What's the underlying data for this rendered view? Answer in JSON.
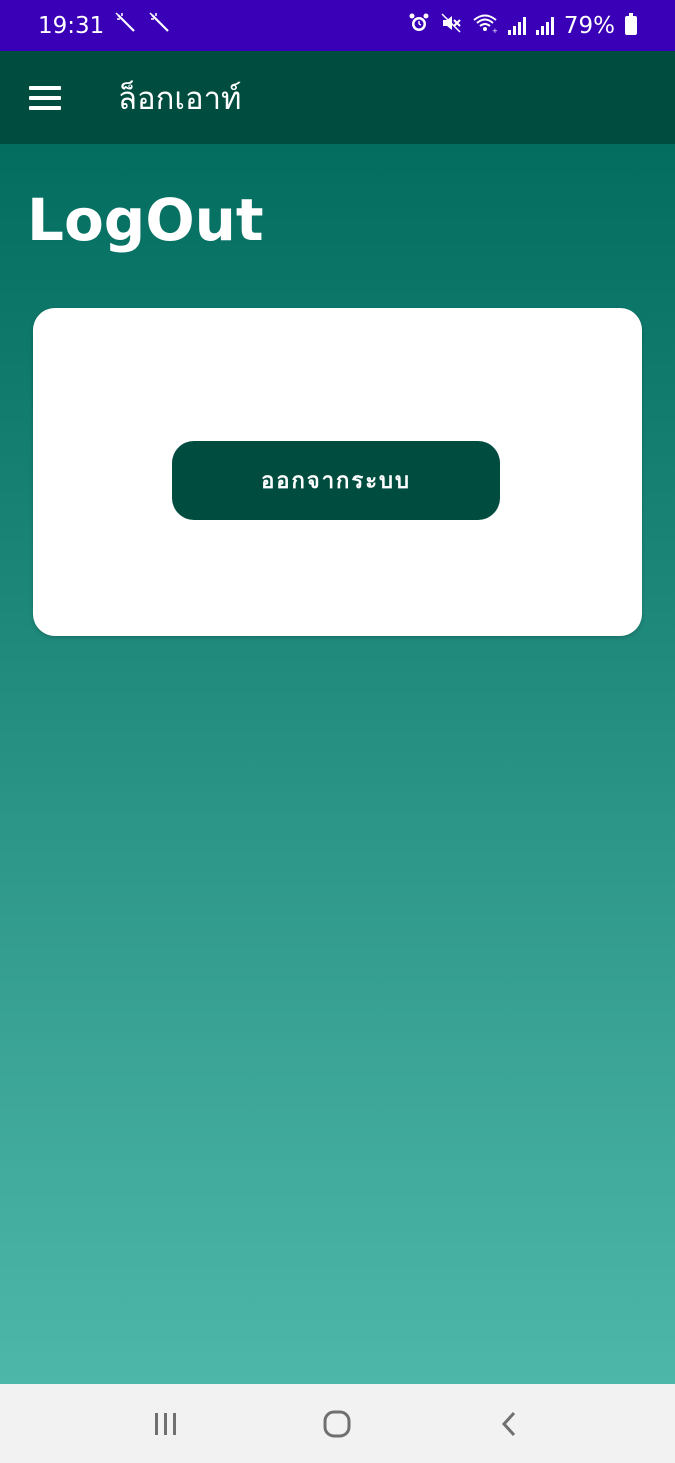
{
  "status_bar": {
    "time": "19:31",
    "left_icons": [
      "magic-wand-icon",
      "magic-wand-icon"
    ],
    "right_icons": [
      "alarm-icon",
      "mute-icon",
      "wifi-icon",
      "signal-icon",
      "signal-icon",
      "battery-icon"
    ],
    "battery": "79%",
    "background": "#3a00b8"
  },
  "app_bar": {
    "title": "ล็อกเอาท์",
    "background": "#004d40"
  },
  "main": {
    "heading": "LogOut",
    "logout_button_label": "ออกจากระบบ"
  },
  "nav_bar": {
    "items": [
      "recent-apps-icon",
      "home-icon",
      "back-icon"
    ]
  },
  "colors": {
    "primary_dark": "#004d40",
    "gradient_top": "#036d5f",
    "gradient_bottom": "#4db8aa"
  }
}
